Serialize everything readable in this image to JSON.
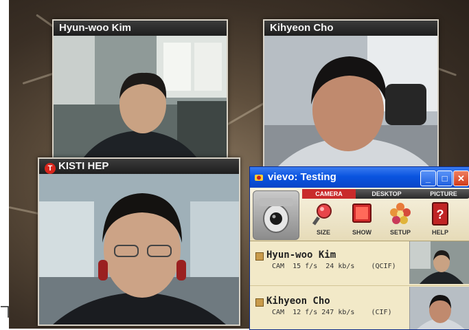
{
  "tiles": {
    "top_left": {
      "name": "Hyun-woo Kim"
    },
    "top_right": {
      "name": "Kihyeon Cho"
    },
    "bottom_left": {
      "name": "KISTI HEP"
    }
  },
  "window": {
    "title": "vievo: Testing",
    "tabs": [
      "CAMERA",
      "DESKTOP",
      "PICTURE"
    ],
    "active_tab": "CAMERA",
    "tools": [
      {
        "label": "SIZE",
        "icon": "magnifier-icon"
      },
      {
        "label": "SHOW",
        "icon": "screen-show-icon"
      },
      {
        "label": "SETUP",
        "icon": "flower-setup-icon"
      },
      {
        "label": "HELP",
        "icon": "help-book-icon"
      }
    ],
    "participants": [
      {
        "name": "Hyun-woo Kim",
        "stats": "CAM  15 f/s  24 kb/s    (QCIF)"
      },
      {
        "name": "Kihyeon Cho",
        "stats": "CAM  12 f/s 247 kb/s    (CIF)"
      }
    ]
  },
  "colors": {
    "titlebar": "#0a54e0",
    "close_button": "#e04a2c",
    "active_tab": "#c92b2b",
    "panel_bg": "#f2e9c8"
  }
}
